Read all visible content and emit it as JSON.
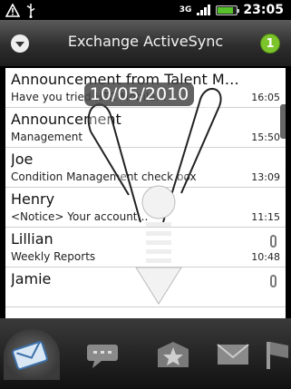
{
  "status_bar": {
    "network": "3G",
    "time": "23:05",
    "battery_level": 0.85
  },
  "titlebar": {
    "title": "Exchange ActiveSync",
    "unread_count": "1"
  },
  "overlay": {
    "date": "10/05/2010"
  },
  "messages": [
    {
      "sender": "Announcement from Talent M…",
      "subject": "Have you tried HTC Mobile…",
      "time": "16:05",
      "attachment": false
    },
    {
      "sender": "Announcement",
      "subject": "Management",
      "time": "15:50",
      "attachment": false
    },
    {
      "sender": "Joe",
      "subject": "Condition Management check box",
      "time": "13:09",
      "attachment": false
    },
    {
      "sender": "Henry",
      "subject": "<Notice> Your account…",
      "time": "11:15",
      "attachment": true
    },
    {
      "sender": "Lillian",
      "subject": "Weekly Reports",
      "time": "10:48",
      "attachment": true
    },
    {
      "sender": "Jamie",
      "subject": "",
      "time": "",
      "attachment": true
    }
  ],
  "tabs": [
    {
      "name": "inbox-tab",
      "icon": "envelope-inbox-icon",
      "active": true
    },
    {
      "name": "conversations-tab",
      "icon": "chat-bubbles-icon",
      "active": false
    },
    {
      "name": "favorites-tab",
      "icon": "star-icon",
      "active": false
    },
    {
      "name": "unread-tab",
      "icon": "envelope-icon",
      "active": false
    },
    {
      "name": "flagged-tab",
      "icon": "flag-icon",
      "active": false
    }
  ],
  "colors": {
    "accent_green": "#7cc42b",
    "titlebar": "#2e2e2e",
    "battery": "#57c12a"
  }
}
